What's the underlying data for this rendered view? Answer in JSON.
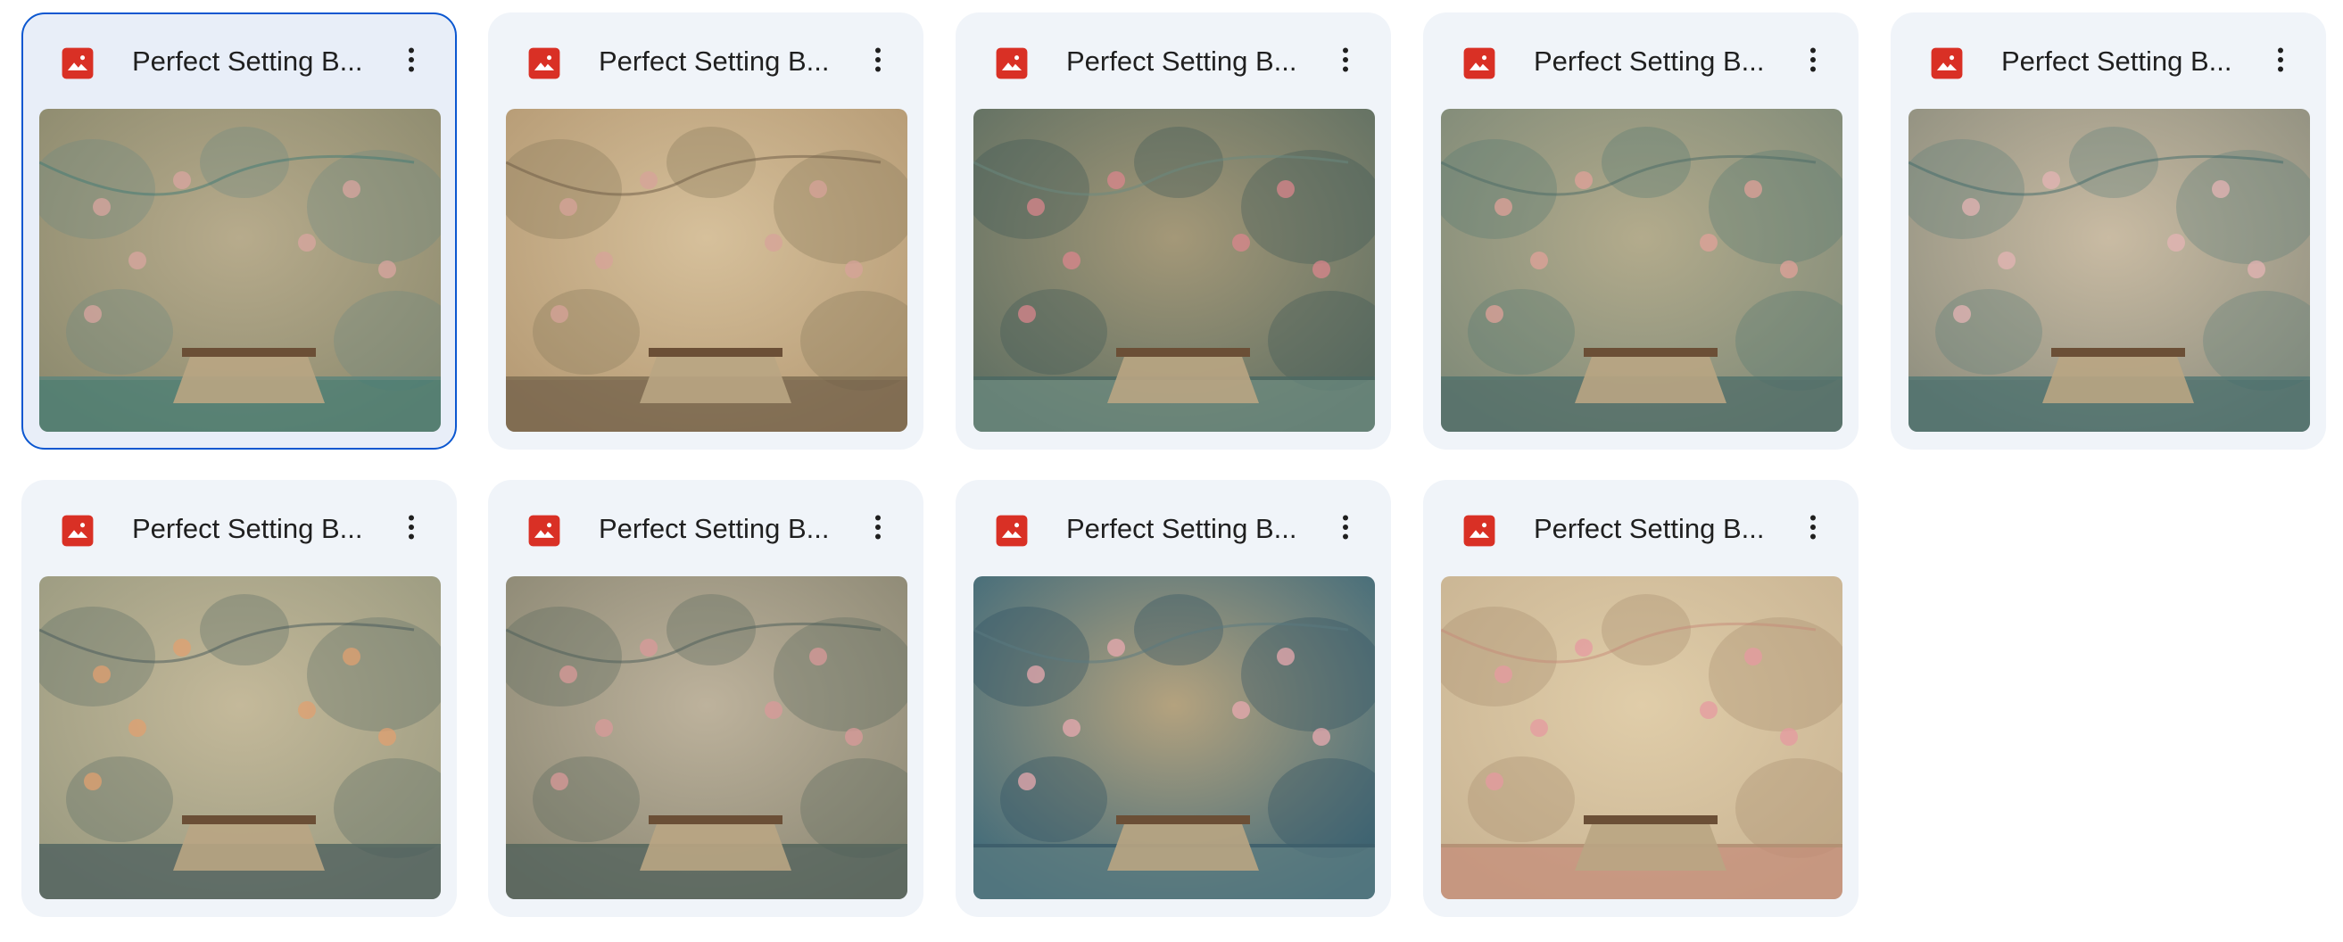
{
  "files": [
    {
      "title": "Perfect Setting B...",
      "selected": true,
      "palette": [
        "#8c8a6e",
        "#b7ab8c",
        "#6f8a80",
        "#3f7a74"
      ],
      "flower": "#d9a6a0"
    },
    {
      "title": "Perfect Setting B...",
      "selected": false,
      "palette": [
        "#b59a74",
        "#d6c09b",
        "#8a7a5c",
        "#6b5a44"
      ],
      "flower": "#d7a39a"
    },
    {
      "title": "Perfect Setting B...",
      "selected": false,
      "palette": [
        "#5f6f62",
        "#a49878",
        "#3f5a55",
        "#6a8a80"
      ],
      "flower": "#d9868c"
    },
    {
      "title": "Perfect Setting B...",
      "selected": false,
      "palette": [
        "#7f8a78",
        "#b3ab8c",
        "#5a7a72",
        "#4a6a66"
      ],
      "flower": "#e0a29a"
    },
    {
      "title": "Perfect Setting B...",
      "selected": false,
      "palette": [
        "#8f8f7f",
        "#c9bba3",
        "#62807a",
        "#3f6a6a"
      ],
      "flower": "#e4b4b4"
    },
    {
      "title": "Perfect Setting B...",
      "selected": false,
      "palette": [
        "#9a9a80",
        "#c4b99a",
        "#5e6f66",
        "#45585a"
      ],
      "flower": "#e0a070"
    },
    {
      "title": "Perfect Setting B...",
      "selected": false,
      "palette": [
        "#8c8874",
        "#bdb29c",
        "#5c6a5e",
        "#4a5c58"
      ],
      "flower": "#d99a9a"
    },
    {
      "title": "Perfect Setting B...",
      "selected": false,
      "palette": [
        "#3f6a7a",
        "#b4a27e",
        "#2f5060",
        "#5a7a80"
      ],
      "flower": "#e8aab0"
    },
    {
      "title": "Perfect Setting B...",
      "selected": false,
      "palette": [
        "#c9b493",
        "#e0cda9",
        "#a89070",
        "#c58a78"
      ],
      "flower": "#e59aa0"
    }
  ],
  "icons": {
    "file": "image-file-icon",
    "more": "more-vert-icon"
  },
  "colors": {
    "file_icon": "#d93025",
    "selected_border": "#0b57d0",
    "card_bg": "#f0f4f9"
  }
}
